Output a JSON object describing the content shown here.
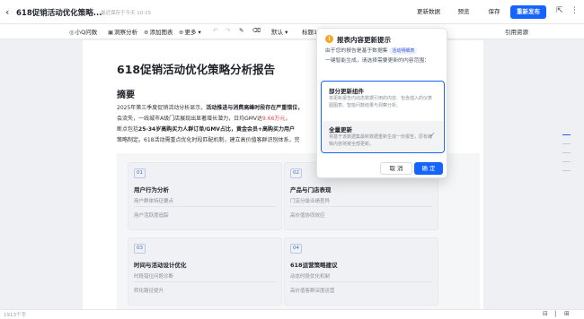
{
  "header": {
    "title": "618促销活动优化策略...",
    "saved_status": "最近保存于今天 10:15",
    "update_data": "更新数据",
    "preview": "预览",
    "save": "保存",
    "publish": "重新发布"
  },
  "toolbar": {
    "ask": "小Q问数",
    "insight": "洞察分析",
    "add_chart": "添加图表",
    "more": "更多",
    "style": "默认",
    "heading": "标题1",
    "cite": "引用资源"
  },
  "doc": {
    "title": "618促销活动优化策略分析报告",
    "h2": "摘要",
    "p1": "2025年第三季度促销活动分析显示，",
    "p1_bold": "活动推进与消费高峰时段存在严重错位，",
    "p2_a": "会流失，一线城市A级门店展现出显著增长潜力，日均GMV达",
    "p2_hl": "9.66万元",
    "p2_b": "，",
    "p3_a": "断点包括",
    "p3_bold": "25-34岁高购买力人群订单/GMV占比",
    "p3_b": "，黄金会员+高购买力用户",
    "p4": "策略制定。618活动需重点优化时段匹配机制，建立高价值客群识别体系，完"
  },
  "cards": [
    {
      "num": "01",
      "title": "用户行为分析",
      "l1": "用户群体特征要点",
      "l2": "用户活跃度追踪"
    },
    {
      "num": "02",
      "title": "产品与门店表现",
      "l1": "门店分级业绩差异",
      "l2": "高价值协同效应"
    },
    {
      "num": "03",
      "title": "时间与活动设计优化",
      "l1": "时段错位问题诊断",
      "l2": "转化路径提升"
    },
    {
      "num": "04",
      "title": "618运营策略建议",
      "l1": "动态时段优化机制",
      "l2": "高价值客群深度运营"
    }
  ],
  "footer": {
    "word_count": "1913个字"
  },
  "popup": {
    "title": "报表内容更新提示",
    "desc_a": "由于您的报告是基于数据集",
    "dataset_tag": "活动明细表",
    "desc_b": "一键智能生成，请选择需要更新的内容范围：",
    "option_partial_title": "部分更新组件",
    "option_partial_desc": "将更新报告内动态数据引用的内容、包含插入的仪表图图表、智能问数结果与洞察分析。",
    "option_full_title": "全量更新",
    "option_full_desc": "将基于该数据集最新数据重新生成一份报告，原有编辑内容将被全部更新。",
    "cancel": "取 消",
    "confirm": "确 定"
  },
  "colors": {
    "accent": "#1664ff",
    "highlight": "#e5484d"
  }
}
